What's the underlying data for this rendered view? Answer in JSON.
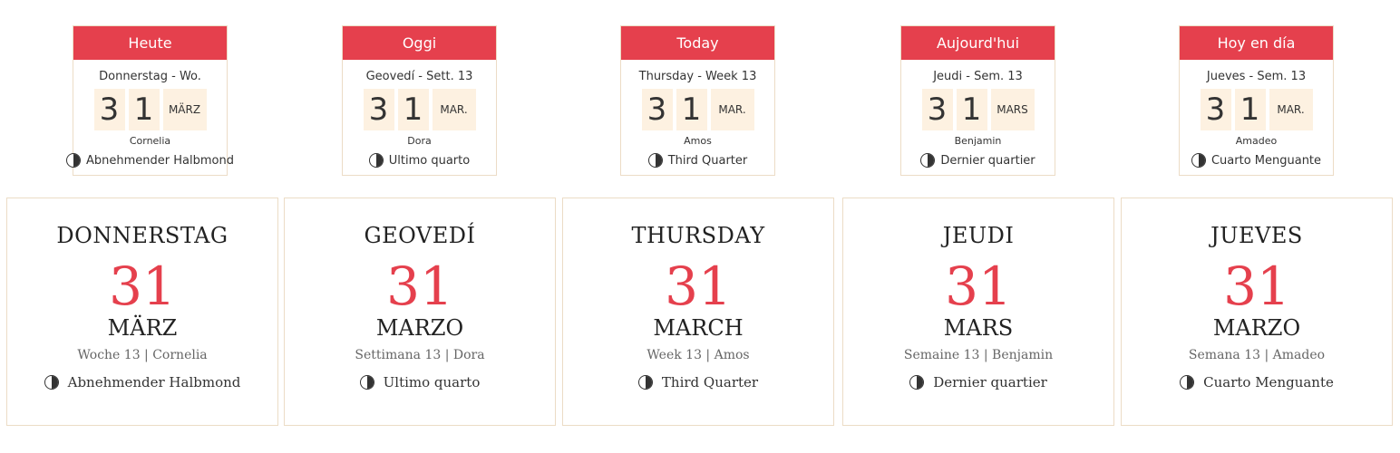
{
  "small_cards": [
    {
      "header": "Heute",
      "week": "Donnerstag - Wo.",
      "d1": "3",
      "d2": "1",
      "month": "MÄRZ",
      "name": "Cornelia",
      "moon": "Abnehmender Halbmond"
    },
    {
      "header": "Oggi",
      "week": "Geovedí - Sett. 13",
      "d1": "3",
      "d2": "1",
      "month": "MAR.",
      "name": "Dora",
      "moon": "Ultimo quarto"
    },
    {
      "header": "Today",
      "week": "Thursday - Week 13",
      "d1": "3",
      "d2": "1",
      "month": "MAR.",
      "name": "Amos",
      "moon": "Third Quarter"
    },
    {
      "header": "Aujourd'hui",
      "week": "Jeudi - Sem. 13",
      "d1": "3",
      "d2": "1",
      "month": "MARS",
      "name": "Benjamin",
      "moon": "Dernier quartier"
    },
    {
      "header": "Hoy en día",
      "week": "Jueves - Sem. 13",
      "d1": "3",
      "d2": "1",
      "month": "MAR.",
      "name": "Amadeo",
      "moon": "Cuarto Menguante"
    }
  ],
  "big_cards": [
    {
      "day": "DONNERSTAG",
      "date": "31",
      "month": "MÄRZ",
      "sub": "Woche 13 | Cornelia",
      "moon": "Abnehmender Halbmond"
    },
    {
      "day": "GEOVEDÍ",
      "date": "31",
      "month": "MARZO",
      "sub": "Settimana 13 | Dora",
      "moon": "Ultimo quarto"
    },
    {
      "day": "THURSDAY",
      "date": "31",
      "month": "MARCH",
      "sub": "Week 13 | Amos",
      "moon": "Third Quarter"
    },
    {
      "day": "JEUDI",
      "date": "31",
      "month": "MARS",
      "sub": "Semaine 13 | Benjamin",
      "moon": "Dernier quartier"
    },
    {
      "day": "JUEVES",
      "date": "31",
      "month": "MARZO",
      "sub": "Semana 13 | Amadeo",
      "moon": "Cuarto Menguante"
    }
  ],
  "colors": {
    "accent": "#e5404d",
    "digit_bg": "#fdf1e1",
    "border": "#ecdcc6"
  },
  "icons": {
    "moon_phase": "half-moon-icon"
  }
}
